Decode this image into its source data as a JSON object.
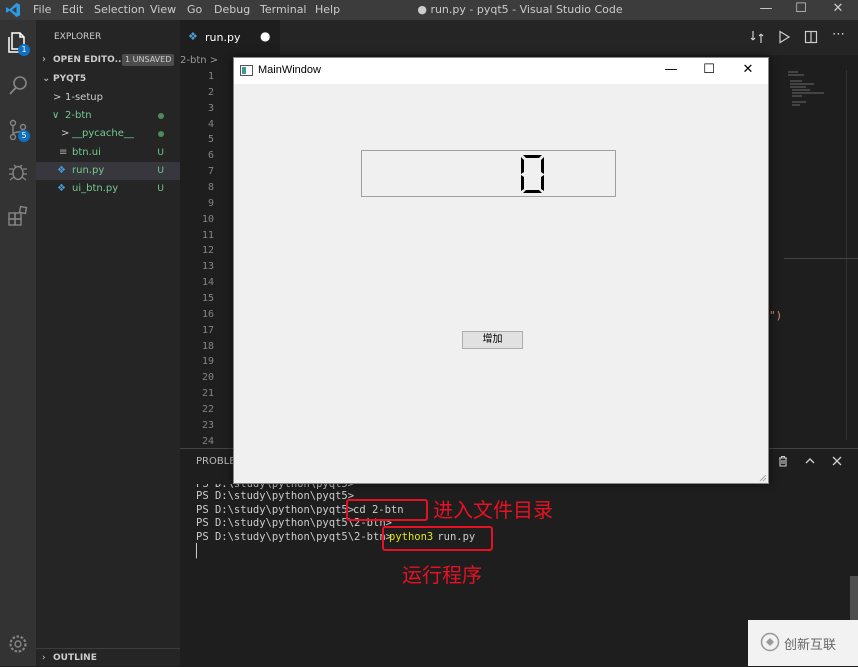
{
  "titlebar": {
    "menu": [
      "File",
      "Edit",
      "Selection",
      "View",
      "Go",
      "Debug",
      "Terminal",
      "Help"
    ],
    "window_title": "● run.py - pyqt5 - Visual Studio Code"
  },
  "activitybar": {
    "explorer_badge": "1",
    "scm_badge": "5"
  },
  "sidebar": {
    "header": "EXPLORER",
    "open_editors": "OPEN EDITO...",
    "unsaved": "1 UNSAVED",
    "folder": "PYQT5",
    "items": [
      {
        "label": "1-setup",
        "arrow": ">",
        "status": ""
      },
      {
        "label": "2-btn",
        "arrow": "∨",
        "status": "dot"
      },
      {
        "label": "__pycache__",
        "arrow": ">",
        "status": "dot"
      },
      {
        "label": "btn.ui",
        "arrow": "",
        "status": "U"
      },
      {
        "label": "run.py",
        "arrow": "",
        "status": "U"
      },
      {
        "label": "ui_btn.py",
        "arrow": "",
        "status": "U"
      }
    ],
    "outline": "OUTLINE"
  },
  "editor": {
    "tab_label": "run.py",
    "tab_dot": "●",
    "breadcrumb": "2-btn >",
    "line_numbers": [
      "1",
      "2",
      "3",
      "4",
      "5",
      "6",
      "7",
      "8",
      "9",
      "10",
      "11",
      "12",
      "13",
      "14",
      "15",
      "16",
      "17",
      "18",
      "19",
      "20",
      "21",
      "22",
      "23",
      "24"
    ],
    "right_fragment": "\")"
  },
  "panel": {
    "title": "PROBLEMS",
    "lines": [
      "PS D:\\study\\python\\pyqt5>",
      "PS D:\\study\\python\\pyqt5>",
      "PS D:\\study\\python\\pyqt5>",
      "PS D:\\study\\python\\pyqt5\\2-btn>",
      "PS D:\\study\\python\\pyqt5\\2-btn>"
    ],
    "cmd1": "cd 2-btn",
    "cmd2_kw": "python3",
    "cmd2_arg": " run.py",
    "cursor": "▏",
    "annotation1": "进入文件目录",
    "annotation2": "运行程序"
  },
  "mainwindow": {
    "title": "MainWindow",
    "lcd_value": "0",
    "button_label": "增加"
  },
  "watermark": {
    "text": "创新互联"
  },
  "colors": {
    "accent": "#0e70c0",
    "annotation": "#e81123",
    "git_untracked": "#73c991"
  }
}
